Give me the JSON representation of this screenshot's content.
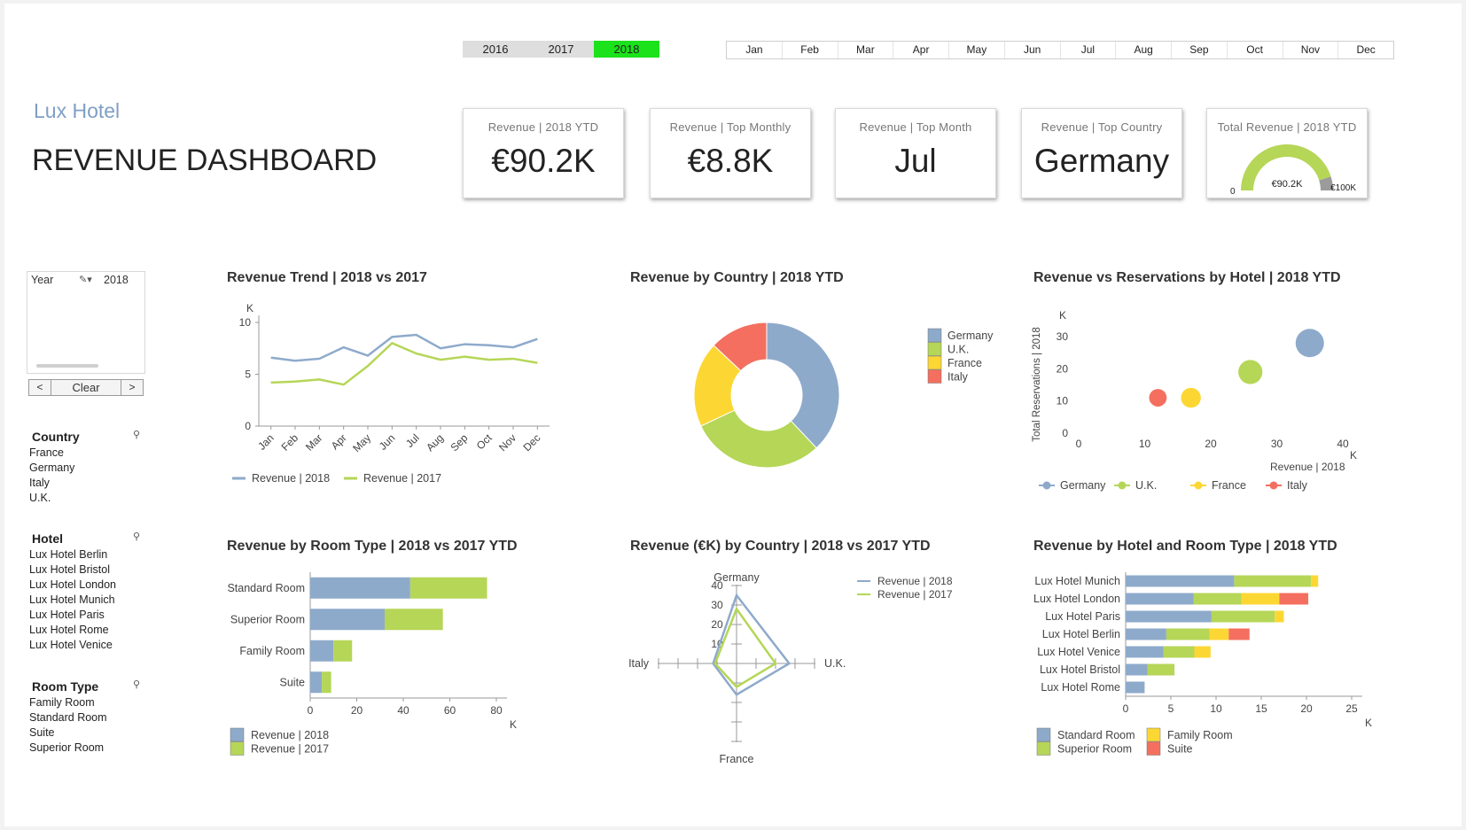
{
  "filters_top": {
    "years": [
      "2016",
      "2017",
      "2018"
    ],
    "selected_year": "2018",
    "months": [
      "Jan",
      "Feb",
      "Mar",
      "Apr",
      "May",
      "Jun",
      "Jul",
      "Aug",
      "Sep",
      "Oct",
      "Nov",
      "Dec"
    ]
  },
  "header": {
    "brand": "Lux Hotel",
    "title": "REVENUE DASHBOARD"
  },
  "kpis": [
    {
      "title": "Revenue | 2018 YTD",
      "value": "€90.2K"
    },
    {
      "title": "Revenue | Top Monthly",
      "value": "€8.8K"
    },
    {
      "title": "Revenue | Top Month",
      "value": "Jul"
    },
    {
      "title": "Revenue | Top Country",
      "value": "Germany"
    }
  ],
  "gauge": {
    "title": "Total Revenue | 2018 YTD",
    "value_label": "€90.2K",
    "min_label": "0",
    "max_label": "€100K",
    "fraction": 0.902,
    "fill_color": "#b5d657",
    "rest_color": "#9b9b9b"
  },
  "year_listbox": {
    "label": "Year",
    "value": "2018",
    "prev": "<",
    "clear": "Clear",
    "next": ">"
  },
  "filters": {
    "country": {
      "label": "Country",
      "items": [
        "France",
        "Germany",
        "Italy",
        "U.K."
      ]
    },
    "hotel": {
      "label": "Hotel",
      "items": [
        "Lux Hotel Berlin",
        "Lux Hotel Bristol",
        "Lux Hotel London",
        "Lux Hotel Munich",
        "Lux Hotel Paris",
        "Lux Hotel Rome",
        "Lux Hotel Venice"
      ]
    },
    "room_type": {
      "label": "Room Type",
      "items": [
        "Family Room",
        "Standard Room",
        "Suite",
        "Superior Room"
      ]
    }
  },
  "colors": {
    "blue": "#8eaacb",
    "green": "#b5d657",
    "yellow": "#fcd734",
    "red": "#f46f5f",
    "grey": "#9b9b9b"
  },
  "chart_data": [
    {
      "id": "trend",
      "type": "line",
      "title": "Revenue Trend | 2018 vs 2017",
      "unit": "K",
      "categories": [
        "Jan",
        "Feb",
        "Mar",
        "Apr",
        "May",
        "Jun",
        "Jul",
        "Aug",
        "Sep",
        "Oct",
        "Nov",
        "Dec"
      ],
      "ylim": [
        0,
        10
      ],
      "yticks": [
        "0",
        "5",
        "10"
      ],
      "series": [
        {
          "name": "Revenue | 2018",
          "color": "#8eaacb",
          "values": [
            6.6,
            6.3,
            6.5,
            7.6,
            6.8,
            8.6,
            8.8,
            7.5,
            7.9,
            7.8,
            7.6,
            8.4
          ]
        },
        {
          "name": "Revenue | 2017",
          "color": "#b5d657",
          "values": [
            4.2,
            4.3,
            4.5,
            4.0,
            5.8,
            8.0,
            7.0,
            6.4,
            6.7,
            6.4,
            6.5,
            6.1
          ]
        }
      ]
    },
    {
      "id": "country_pie",
      "type": "pie",
      "title": "Revenue by Country | 2018 YTD",
      "slices": [
        {
          "name": "Germany",
          "value": 38,
          "color": "#8eaacb"
        },
        {
          "name": "U.K.",
          "value": 30,
          "color": "#b5d657"
        },
        {
          "name": "France",
          "value": 19,
          "color": "#fcd734"
        },
        {
          "name": "Italy",
          "value": 13,
          "color": "#f46f5f"
        }
      ]
    },
    {
      "id": "hotel_scatter",
      "type": "scatter",
      "title": "Revenue vs Reservations by Hotel | 2018 YTD",
      "xlabel": "Revenue | 2018",
      "ylabel": "Total Reservations | 2018",
      "xunit": "K",
      "yunit": "K",
      "xlim": [
        0,
        40
      ],
      "ylim": [
        0,
        30
      ],
      "xticks": [
        "0",
        "10",
        "20",
        "30",
        "40"
      ],
      "yticks": [
        "0",
        "10",
        "20",
        "30"
      ],
      "points": [
        {
          "name": "Germany",
          "x": 35,
          "y": 28,
          "size": 1.0,
          "color": "#8eaacb"
        },
        {
          "name": "U.K.",
          "x": 26,
          "y": 19,
          "size": 0.85,
          "color": "#b5d657"
        },
        {
          "name": "France",
          "x": 17,
          "y": 11,
          "size": 0.7,
          "color": "#fcd734"
        },
        {
          "name": "Italy",
          "x": 12,
          "y": 11,
          "size": 0.62,
          "color": "#f46f5f"
        }
      ]
    },
    {
      "id": "room_bar",
      "type": "bar",
      "title": "Revenue by Room Type | 2018 vs 2017 YTD",
      "orientation": "horizontal",
      "stacked": true,
      "xunit": "K",
      "xlim": [
        0,
        80
      ],
      "xticks": [
        "0",
        "20",
        "40",
        "60",
        "80"
      ],
      "categories": [
        "Standard Room",
        "Superior Room",
        "Family Room",
        "Suite"
      ],
      "series": [
        {
          "name": "Revenue | 2018",
          "color": "#8eaacb",
          "values": [
            43,
            32,
            10,
            5
          ]
        },
        {
          "name": "Revenue | 2017",
          "color": "#b5d657",
          "values": [
            33,
            25,
            8,
            4
          ]
        }
      ]
    },
    {
      "id": "country_radar",
      "type": "radar",
      "title": "Revenue (€K) by Country | 2018 vs 2017 YTD",
      "axes": [
        "Germany",
        "U.K.",
        "France",
        "Italy"
      ],
      "rlim": [
        0,
        40
      ],
      "rticks": [
        "10",
        "20",
        "30",
        "40"
      ],
      "series": [
        {
          "name": "Revenue | 2018",
          "color": "#8eaacb",
          "values": [
            35,
            27,
            16,
            12
          ]
        },
        {
          "name": "Revenue | 2017",
          "color": "#b5d657",
          "values": [
            28,
            20,
            12,
            11
          ]
        }
      ]
    },
    {
      "id": "hotel_room_bar",
      "type": "bar",
      "title": "Revenue by Hotel and Room Type | 2018 YTD",
      "orientation": "horizontal",
      "stacked": true,
      "xunit": "K",
      "xlim": [
        0,
        25
      ],
      "xticks": [
        "0",
        "5",
        "10",
        "15",
        "20",
        "25"
      ],
      "categories": [
        "Lux Hotel Munich",
        "Lux Hotel London",
        "Lux Hotel Paris",
        "Lux Hotel Berlin",
        "Lux Hotel Venice",
        "Lux Hotel Bristol",
        "Lux Hotel Rome"
      ],
      "series": [
        {
          "name": "Standard Room",
          "color": "#8eaacb",
          "values": [
            12,
            7.5,
            9.5,
            4.5,
            4.2,
            2.4,
            2.1
          ]
        },
        {
          "name": "Superior Room",
          "color": "#b5d657",
          "values": [
            8.5,
            5.3,
            7,
            4.8,
            3.4,
            3.0,
            0
          ]
        },
        {
          "name": "Family Room",
          "color": "#fcd734",
          "values": [
            0.8,
            4.2,
            1.0,
            2.1,
            1.8,
            0,
            0
          ]
        },
        {
          "name": "Suite",
          "color": "#f46f5f",
          "values": [
            0,
            3.2,
            0,
            2.3,
            0,
            0,
            0
          ]
        }
      ]
    }
  ]
}
